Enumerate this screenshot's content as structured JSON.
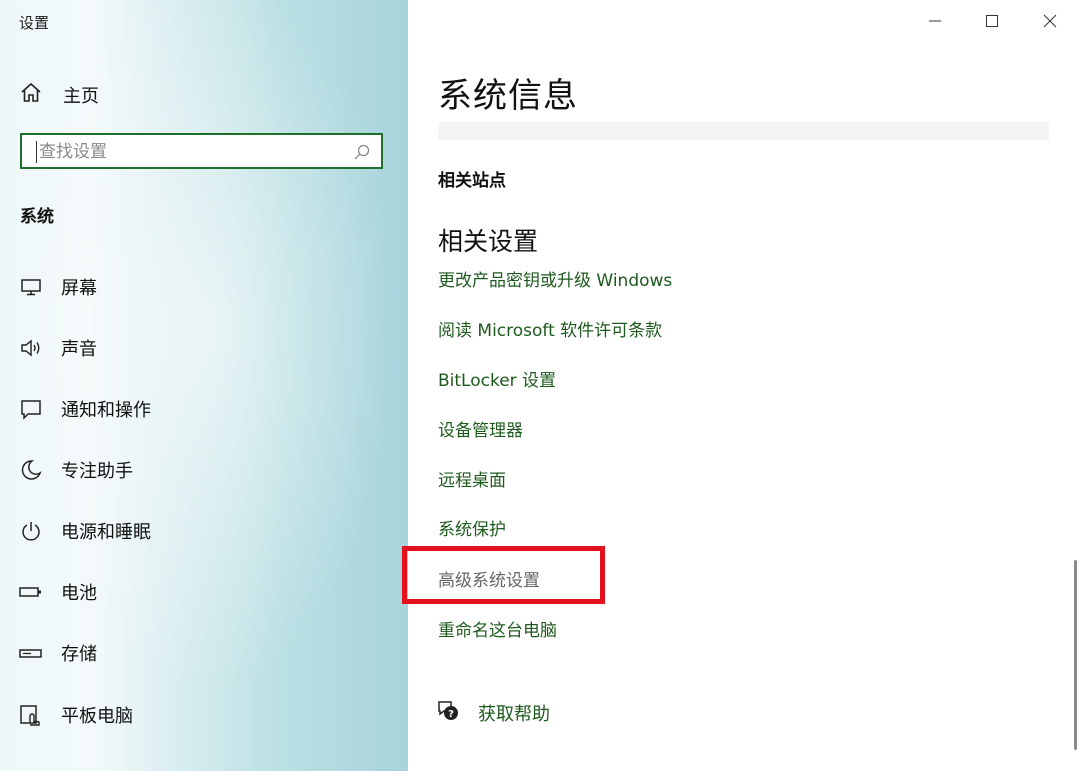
{
  "window": {
    "title": "设置",
    "controls": {
      "minimize": "minimize",
      "maximize": "maximize",
      "close": "close"
    }
  },
  "sidebar": {
    "home_label": "主页",
    "search_placeholder": "查找设置",
    "section_label": "系统",
    "items": [
      {
        "label": "屏幕",
        "icon": "monitor-icon"
      },
      {
        "label": "声音",
        "icon": "speaker-icon"
      },
      {
        "label": "通知和操作",
        "icon": "notification-icon"
      },
      {
        "label": "专注助手",
        "icon": "moon-icon"
      },
      {
        "label": "电源和睡眠",
        "icon": "power-icon"
      },
      {
        "label": "电池",
        "icon": "battery-icon"
      },
      {
        "label": "存储",
        "icon": "storage-icon"
      },
      {
        "label": "平板电脑",
        "icon": "tablet-icon"
      }
    ]
  },
  "main": {
    "title": "系统信息",
    "related_sites_label": "相关站点",
    "related_settings_label": "相关设置",
    "links": [
      "更改产品密钥或升级 Windows",
      "阅读 Microsoft 软件许可条款",
      "BitLocker 设置",
      "设备管理器",
      "远程桌面",
      "系统保护",
      "高级系统设置",
      "重命名这台电脑"
    ],
    "highlighted_link": "高级系统设置",
    "help_label": "获取帮助"
  },
  "colors": {
    "link": "#1e5a1e",
    "search_border": "#1f6f2c",
    "highlight_box": "#e3101d"
  }
}
